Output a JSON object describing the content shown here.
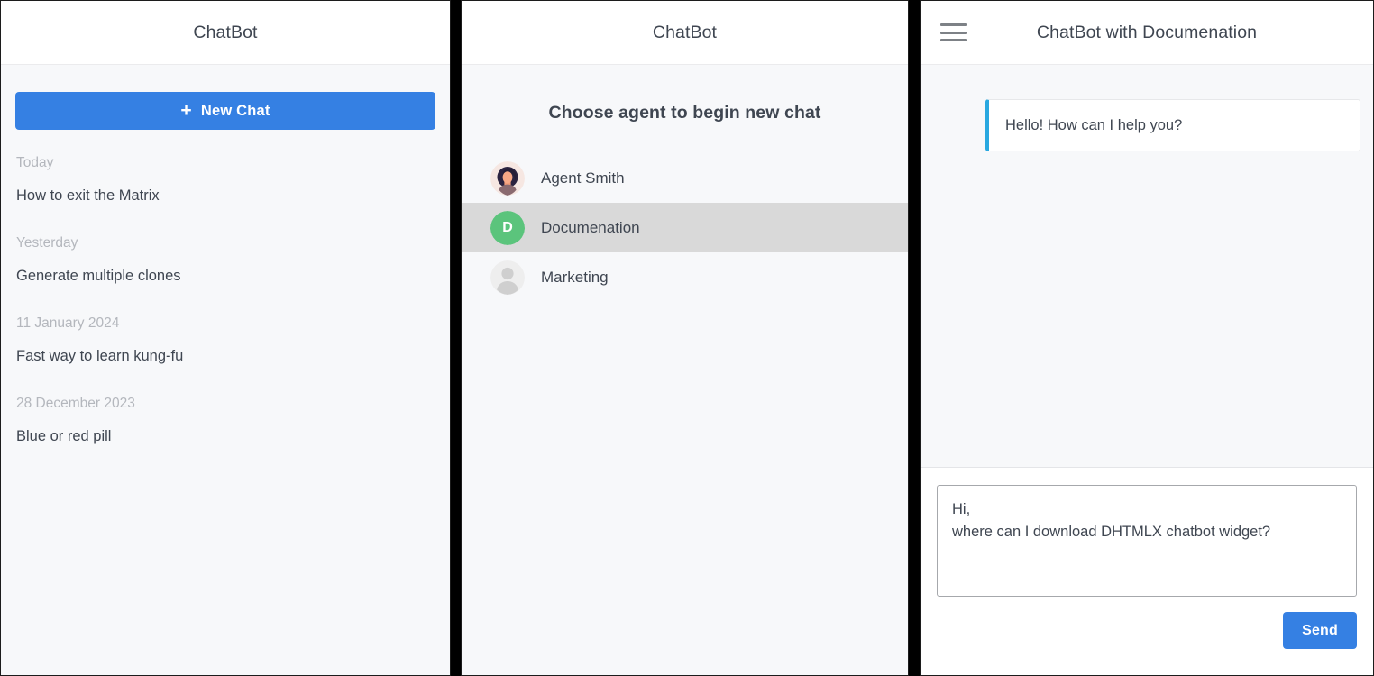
{
  "sidebar_panel": {
    "title": "ChatBot",
    "new_chat_label": "New Chat",
    "plus_icon": "plus-icon",
    "history_groups": [
      {
        "date": "Today",
        "items": [
          "How to exit the Matrix"
        ]
      },
      {
        "date": "Yesterday",
        "items": [
          "Generate multiple clones"
        ]
      },
      {
        "date": "11 January 2024",
        "items": [
          "Fast way to learn kung-fu"
        ]
      },
      {
        "date": "28 December 2023",
        "items": [
          "Blue or red pill"
        ]
      }
    ]
  },
  "agents_panel": {
    "title": "ChatBot",
    "heading": "Choose agent to begin new chat",
    "agents": [
      {
        "name": "Agent Smith",
        "avatar_type": "photo-avatar",
        "selected": false
      },
      {
        "name": "Documenation",
        "avatar_type": "letter-avatar",
        "initial": "D",
        "avatar_color": "#5bc47c",
        "selected": true
      },
      {
        "name": "Marketing",
        "avatar_type": "default-avatar",
        "selected": false
      }
    ]
  },
  "chat_panel": {
    "title": "ChatBot with Documenation",
    "menu_icon": "hamburger-menu-icon",
    "messages": [
      {
        "text": "Hello! How can I help you?",
        "from": "bot",
        "accent": "#29a8e0"
      }
    ],
    "composer": {
      "value": "Hi,\nwhere can I download DHTMLX chatbot widget?",
      "placeholder": "",
      "send_label": "Send"
    }
  },
  "theme": {
    "accent": "#3580e3",
    "bot_accent": "#29a8e0",
    "avatar_green": "#5bc47c",
    "body_bg": "#f7f8fa",
    "header_bg": "#ffffff"
  }
}
